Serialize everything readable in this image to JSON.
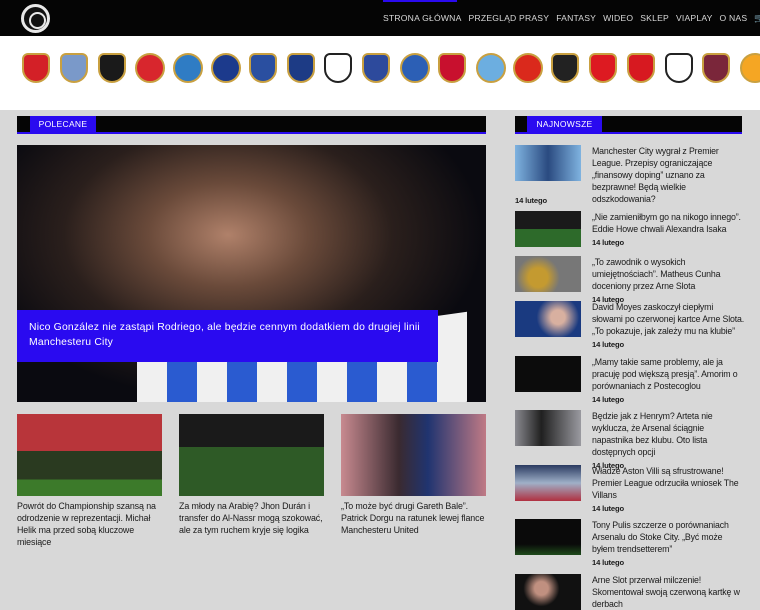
{
  "nav": {
    "items": [
      "STRONA GŁÓWNA",
      "PRZEGLĄD PRASY",
      "FANTASY",
      "WIDEO",
      "SKLEP",
      "VIAPLAY",
      "O NAS"
    ]
  },
  "clubs": [
    {
      "name": "arsenal",
      "color": "#d32027"
    },
    {
      "name": "aston-villa",
      "color": "#7a99c9"
    },
    {
      "name": "bournemouth",
      "color": "#1a1a1a"
    },
    {
      "name": "brentford",
      "color": "#d8262d"
    },
    {
      "name": "brighton",
      "color": "#2f7cc4"
    },
    {
      "name": "chelsea",
      "color": "#1c3a8c"
    },
    {
      "name": "crystal-palace",
      "color": "#2a4fa0"
    },
    {
      "name": "everton",
      "color": "#1d3b85"
    },
    {
      "name": "fulham",
      "color": "#ffffff"
    },
    {
      "name": "ipswich",
      "color": "#2d4a9c"
    },
    {
      "name": "leicester",
      "color": "#2c5fb5"
    },
    {
      "name": "liverpool",
      "color": "#c8102e"
    },
    {
      "name": "manchester-city",
      "color": "#6caee0"
    },
    {
      "name": "manchester-united",
      "color": "#da291c"
    },
    {
      "name": "newcastle",
      "color": "#222222"
    },
    {
      "name": "nottingham-forest",
      "color": "#dd1a21"
    },
    {
      "name": "southampton",
      "color": "#d71920"
    },
    {
      "name": "tottenham",
      "color": "#ffffff"
    },
    {
      "name": "west-ham",
      "color": "#7a263a"
    },
    {
      "name": "wolves",
      "color": "#f5a623"
    }
  ],
  "featured": {
    "label": "POLECANE",
    "hero_title": "Nico González nie zastąpi Rodriego, ale będzie cennym dodatkiem do drugiej linii Manchesteru City",
    "articles": [
      {
        "title": "Powrót do Championship szansą na odrodzenie w reprezentacji. Michał Helik ma przed sobą kluczowe miesiące"
      },
      {
        "title": "Za młody na Arabię? Jhon Durán i transfer do Al-Nassr mogą szokować, ale za tym ruchem kryje się logika"
      },
      {
        "title": "„To może być drugi Gareth Bale”. Patrick Dorgu na ratunek lewej flance Manchesteru United"
      }
    ]
  },
  "latest": {
    "label": "NAJNOWSZE",
    "items": [
      {
        "title": "Manchester City wygrał z Premier League. Przepisy ograniczające „finansowy doping” uznano za bezprawne! Będą wielkie odszkodowania?",
        "date": "14 lutego"
      },
      {
        "title": "„Nie zamieniłbym go na nikogo innego”. Eddie Howe chwali Alexandra Isaka",
        "date": "14 lutego"
      },
      {
        "title": "„To zawodnik o wysokich umiejętnościach”. Matheus Cunha doceniony przez Arne Slota",
        "date": "14 lutego"
      },
      {
        "title": "David Moyes zaskoczył ciepłymi słowami po czerwonej kartce Arne Slota. „To pokazuje, jak zależy mu na klubie”",
        "date": "14 lutego"
      },
      {
        "title": "„Mamy takie same problemy, ale ja pracuję pod większą presją”. Amorim o porównaniach z Postecoglou",
        "date": "14 lutego"
      },
      {
        "title": "Będzie jak z Henrym? Arteta nie wyklucza, że Arsenal ściągnie napastnika bez klubu. Oto lista dostępnych opcji",
        "date": "14 lutego"
      },
      {
        "title": "Władze Aston Villi są sfrustrowane! Premier League odrzuciła wniosek The Villans",
        "date": "14 lutego"
      },
      {
        "title": "Tony Pulis szczerze o porównaniach Arsenalu do Stoke City. „Być może byłem trendsetterem”",
        "date": "14 lutego"
      },
      {
        "title": "Arne Slot przerwał milczenie! Skomentował swoją czerwoną kartkę w derbach",
        "date": ""
      }
    ]
  },
  "colors": {
    "accent": "#2a0af0",
    "background": "#d8d8d8",
    "header": "#050505"
  }
}
